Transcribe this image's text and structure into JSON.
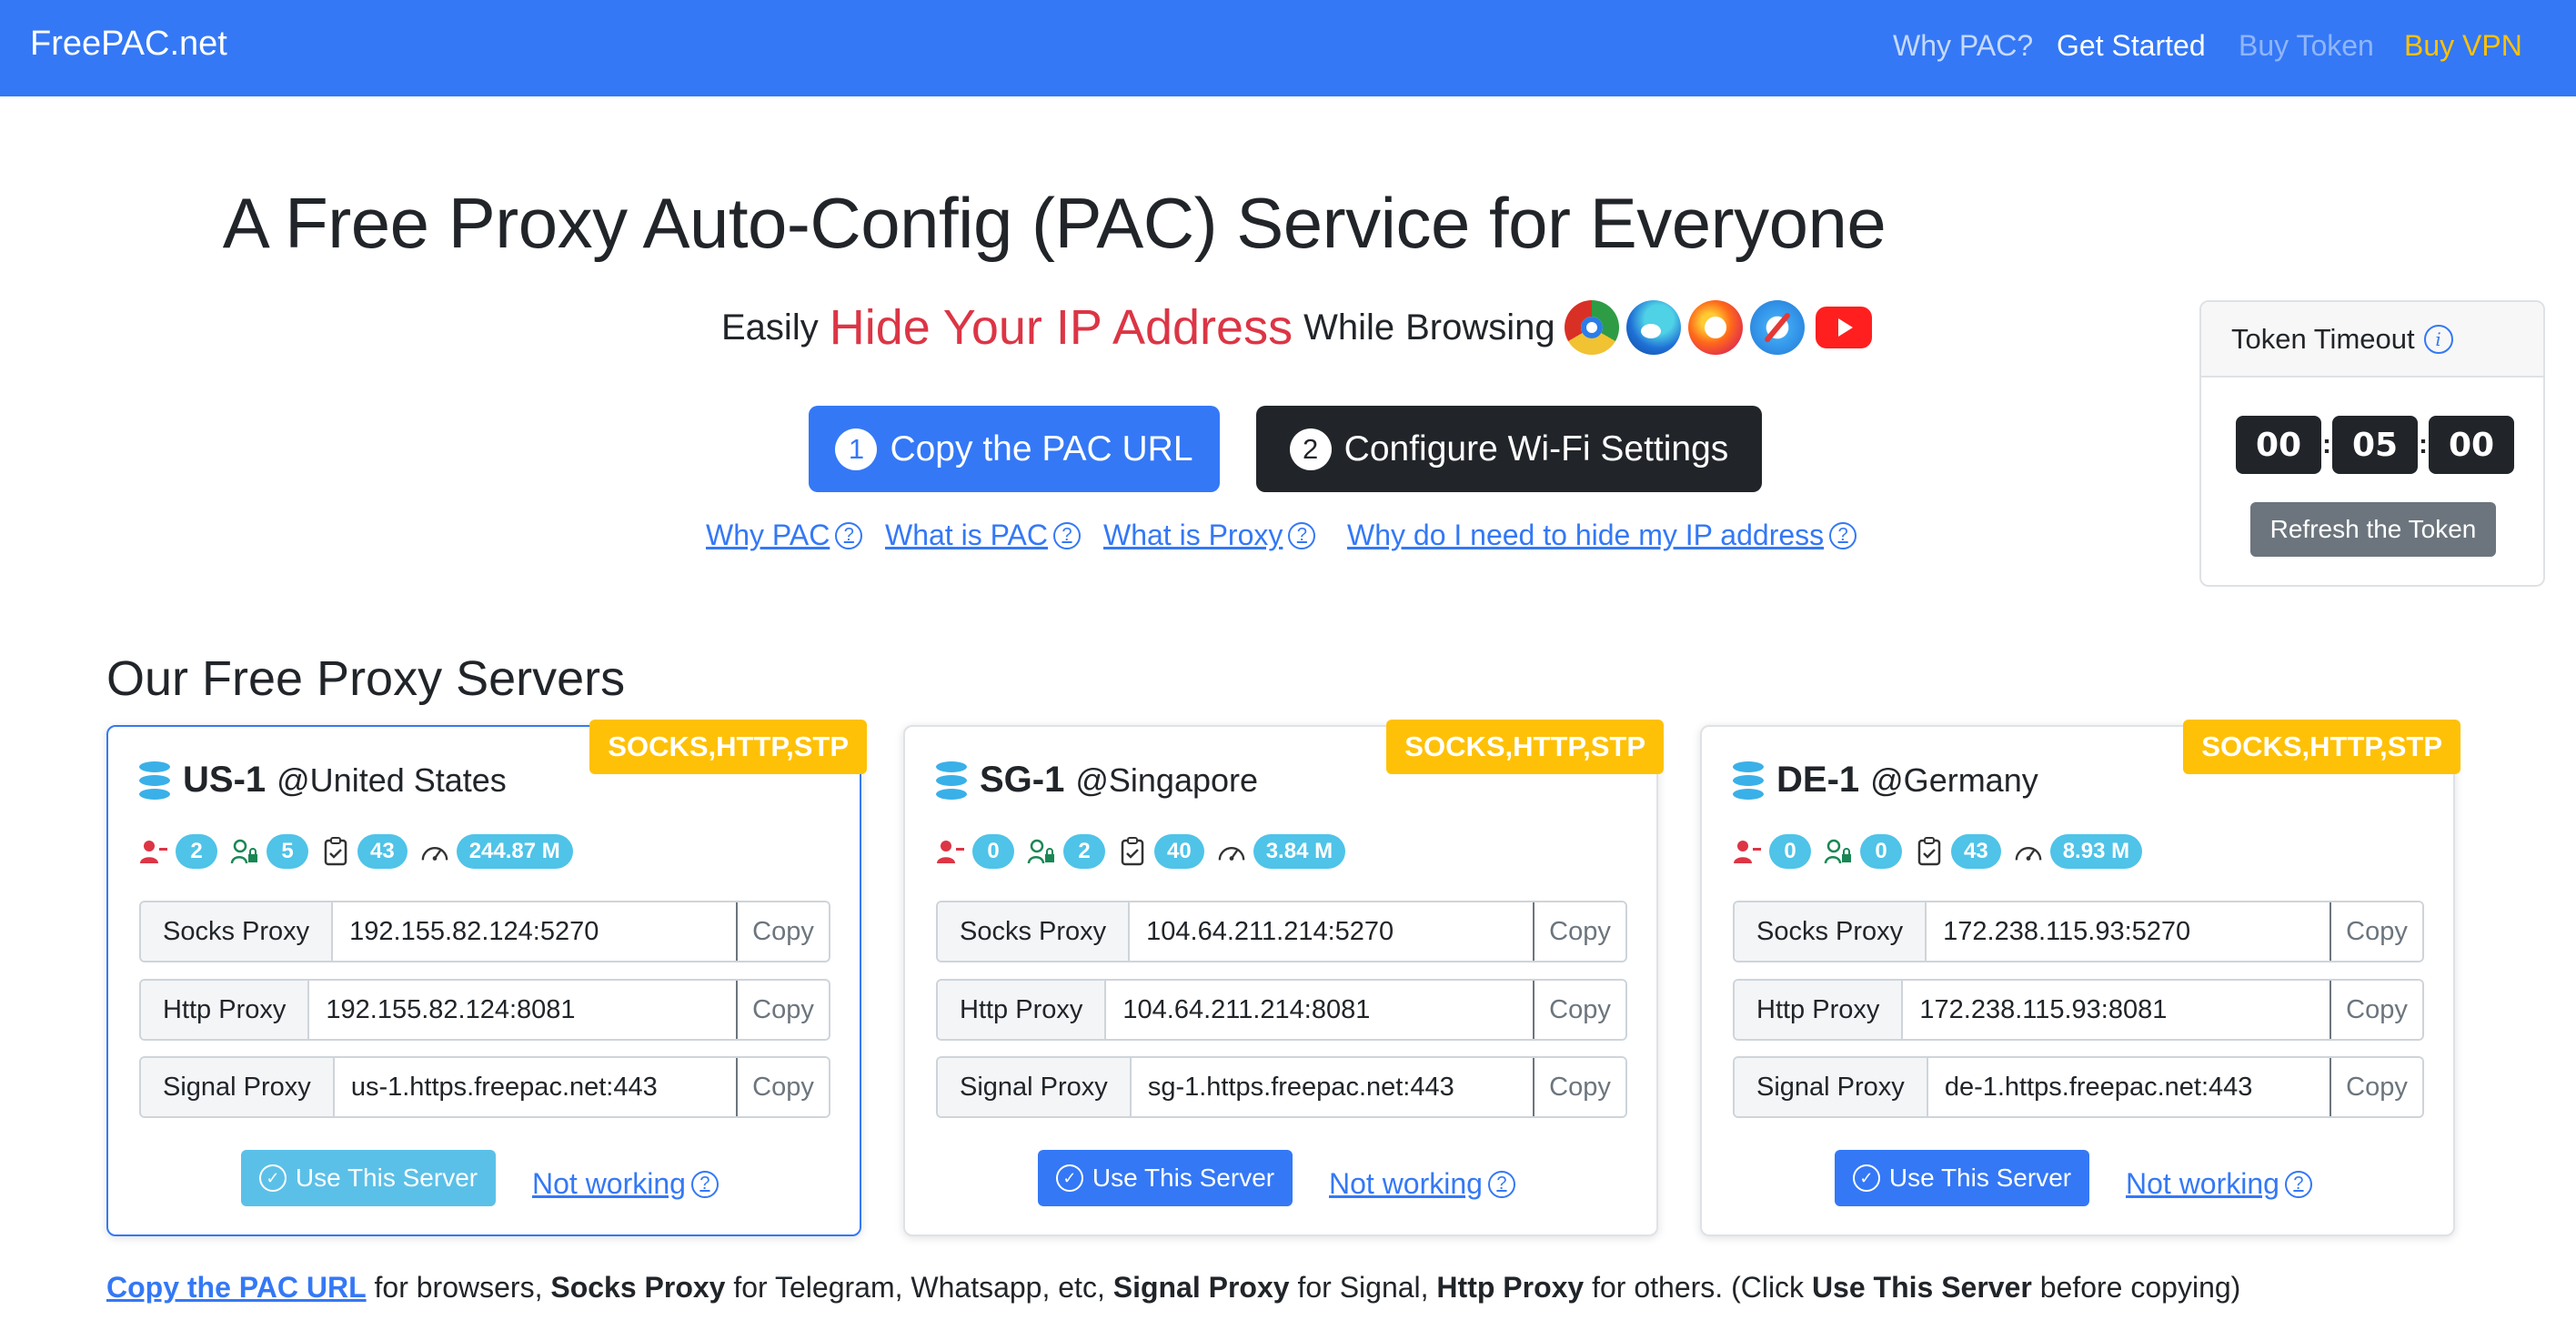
{
  "navbar": {
    "brand": "FreePAC.net",
    "links": {
      "why_pac": "Why PAC?",
      "get_started": "Get Started",
      "buy_token": "Buy Token",
      "buy_vpn": "Buy VPN"
    }
  },
  "hero": {
    "title": "A Free Proxy Auto-Config (PAC) Service for Everyone",
    "subtitle": {
      "part1": "Easily",
      "highlight": "Hide Your IP Address",
      "part2": "While",
      "part3": "Browsing"
    },
    "browser_icons": [
      "chrome-icon",
      "edge-icon",
      "firefox-icon",
      "safari-icon",
      "youtube-icon"
    ],
    "buttons": {
      "copy_pac": {
        "step": "1",
        "label": "Copy the PAC URL"
      },
      "configure": {
        "step": "2",
        "label": "Configure Wi-Fi Settings"
      }
    },
    "help_links": {
      "why_pac": "Why PAC",
      "what_is_pac": "What is PAC",
      "what_is_proxy": "What is Proxy",
      "why_hide_ip": "Why do I need to hide my IP address"
    },
    "help_glyph": "?"
  },
  "token": {
    "title": "Token Timeout",
    "info_glyph": "i",
    "hours": "00",
    "minutes": "05",
    "seconds": "00",
    "separator": ":",
    "refresh_label": "Refresh the Token"
  },
  "servers_section": {
    "title": "Our Free Proxy Servers",
    "copy_label": "Copy",
    "not_working_label": "Not working",
    "use_label": "Use This Server",
    "row_labels": {
      "socks": "Socks Proxy",
      "http": "Http Proxy",
      "signal": "Signal Proxy"
    },
    "servers": [
      {
        "protocols": "SOCKS,HTTP,STP",
        "name": "US-1",
        "location": "@United States",
        "online_users": "2",
        "token_users": "5",
        "tasks": "43",
        "traffic": "244.87 M",
        "socks": "192.155.82.124:5270",
        "http": "192.155.82.124:8081",
        "signal": "us-1.https.freepac.net:443",
        "selected": true
      },
      {
        "protocols": "SOCKS,HTTP,STP",
        "name": "SG-1",
        "location": "@Singapore",
        "online_users": "0",
        "token_users": "2",
        "tasks": "40",
        "traffic": "3.84 M",
        "socks": "104.64.211.214:5270",
        "http": "104.64.211.214:8081",
        "signal": "sg-1.https.freepac.net:443",
        "selected": false
      },
      {
        "protocols": "SOCKS,HTTP,STP",
        "name": "DE-1",
        "location": "@Germany",
        "online_users": "0",
        "token_users": "0",
        "tasks": "43",
        "traffic": "8.93 M",
        "socks": "172.238.115.93:5270",
        "http": "172.238.115.93:8081",
        "signal": "de-1.https.freepac.net:443",
        "selected": false
      }
    ]
  },
  "footer_note": {
    "link": "Copy the PAC URL",
    "t1": " for browsers, ",
    "b1": "Socks Proxy",
    "t2": " for Telegram, Whatsapp, etc, ",
    "b2": "Signal Proxy",
    "t3": " for Signal, ",
    "b3": "Http Proxy",
    "t4": " for others. (Click ",
    "b4": "Use This Server",
    "t5": " before copying)"
  },
  "colors": {
    "primary": "#3478f6",
    "warning": "#ffc107",
    "danger": "#dc3545",
    "dark": "#212529",
    "info": "#4fc3e8",
    "secondary": "#6c757d"
  }
}
